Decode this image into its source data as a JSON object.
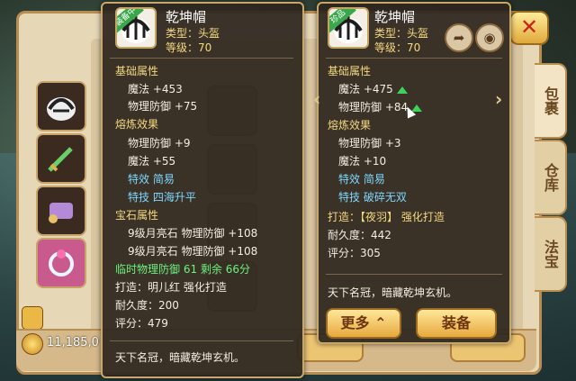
{
  "inventory": {
    "tabs": [
      {
        "label": "包裹"
      },
      {
        "label": "仓库"
      },
      {
        "label": "法宝"
      }
    ],
    "coins": "11,185,0"
  },
  "equipped_tooltip": {
    "badge": "装备中",
    "item_name": "乾坤帽",
    "type_label": "类型：头盔",
    "level_label": "等级：70",
    "basic_header": "基础属性",
    "basic": [
      "魔法 +453",
      "物理防御 +75"
    ],
    "refine_header": "熔炼效果",
    "refine": [
      "物理防御 +9",
      "魔法 +55"
    ],
    "special_effect": "特效  简易",
    "special_skill": "特技  四海升平",
    "gem_header": "宝石属性",
    "gems": [
      "9级月亮石  物理防御 +108",
      "9级月亮石  物理防御 +108"
    ],
    "temp_line": "临时物理防御  61  剩余  66分",
    "forge": "打造：明儿红   强化打造",
    "durability": "耐久度：200",
    "score": "评分：479",
    "description": "天下名冠，暗藏乾坤玄机。"
  },
  "compare_tooltip": {
    "badge": "珍品",
    "item_name": "乾坤帽",
    "type_label": "类型：头盔",
    "level_label": "等级：70",
    "basic_header": "基础属性",
    "basic": [
      "魔法 +475",
      "物理防御 +84"
    ],
    "refine_header": "熔炼效果",
    "refine": [
      "物理防御 +3",
      "魔法 +10"
    ],
    "special_effect": "特效  简易",
    "special_skill": "特技  破碎无双",
    "forge": "打造：【夜羽】   强化打造",
    "durability": "耐久度：442",
    "score": "评分：305",
    "description": "天下名冠，暗藏乾坤玄机。",
    "more_button": "更多",
    "equip_button": "装备"
  },
  "colors": {
    "accent": "#f5d980",
    "cyan": "#7fd8ff",
    "green": "#6cf27e",
    "panel": "#2d261e"
  }
}
